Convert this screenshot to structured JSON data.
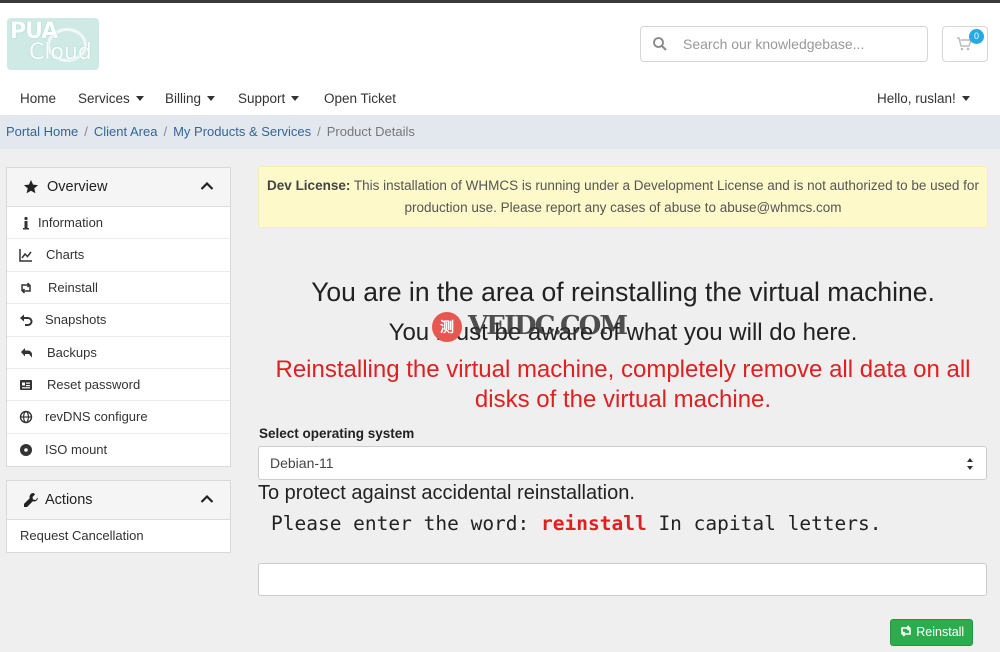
{
  "logo": {
    "line1": "PUA",
    "line2": "Cloud"
  },
  "search": {
    "placeholder": "Search our knowledgebase..."
  },
  "cart": {
    "count": "0"
  },
  "nav": {
    "home": "Home",
    "services": "Services",
    "billing": "Billing",
    "support": "Support",
    "open_ticket": "Open Ticket",
    "user_greeting": "Hello, ruslan!"
  },
  "breadcrumb": {
    "items": [
      "Portal Home",
      "Client Area",
      "My Products & Services"
    ],
    "current": "Product Details"
  },
  "sidebar": {
    "overview": {
      "title": "Overview",
      "items": [
        {
          "label": "Information",
          "icon": "info-icon"
        },
        {
          "label": "Charts",
          "icon": "chart-icon"
        },
        {
          "label": "Reinstall",
          "icon": "retweet-icon"
        },
        {
          "label": "Snapshots",
          "icon": "undo-icon"
        },
        {
          "label": "Backups",
          "icon": "history-icon"
        },
        {
          "label": "Reset password",
          "icon": "id-card-icon"
        },
        {
          "label": "revDNS configure",
          "icon": "globe-icon"
        },
        {
          "label": "ISO mount",
          "icon": "disc-icon"
        }
      ]
    },
    "actions": {
      "title": "Actions",
      "items": [
        {
          "label": "Request Cancellation"
        }
      ]
    }
  },
  "alert": {
    "bold": "Dev License:",
    "text": " This installation of WHMCS is running under a Development License and is not authorized to be used for production use. Please report any cases of abuse to abuse@whmcs.com"
  },
  "main": {
    "heading1": "You are in the area of reinstalling the virtual machine.",
    "heading2": "You must be aware of what you will do here.",
    "warning": "Reinstalling the virtual machine, completely remove all data on all disks of the virtual machine.",
    "os_label": "Select operating system",
    "os_value": "Debian-11",
    "protect_text": "To protect against accidental reinstallation.",
    "enter_prefix": "Please enter the word: ",
    "enter_keyword": "reinstall",
    "enter_suffix": " In capital letters.",
    "confirm_value": "",
    "reinstall_button": "Reinstall"
  },
  "watermark": {
    "circle": "测",
    "text": "VEIDC.COM"
  },
  "colors": {
    "accent_link": "#336699",
    "warning_red": "#e02020",
    "button_green": "#2dac4e",
    "alert_bg": "#fdf9c9",
    "badge_blue": "#27a9e1"
  }
}
